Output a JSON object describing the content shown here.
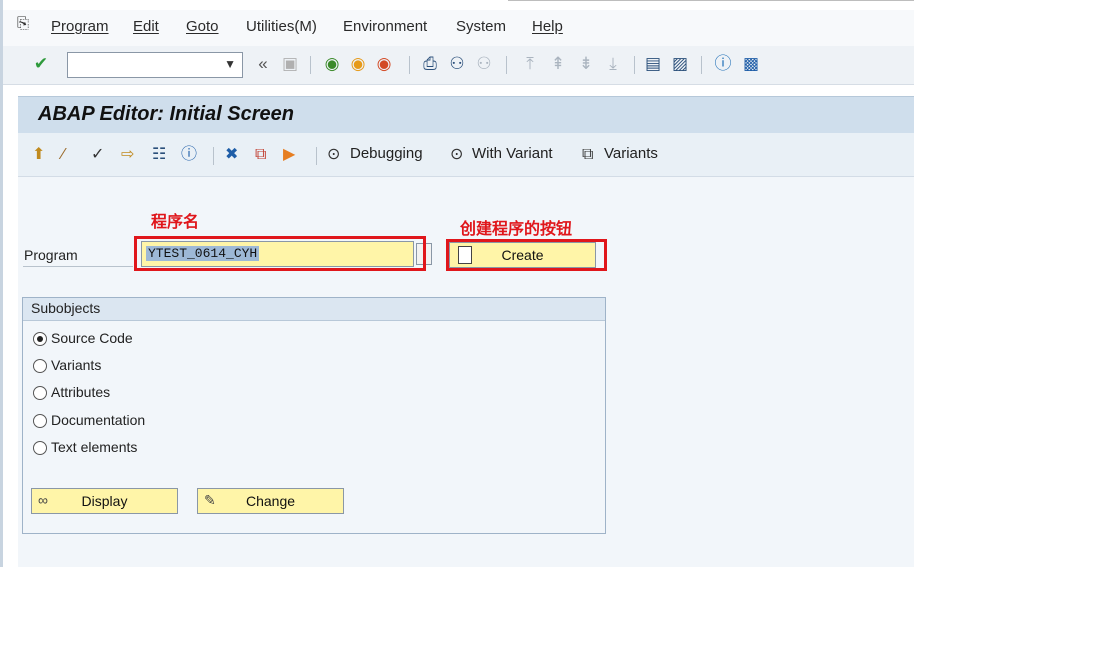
{
  "menu": {
    "items": [
      "Program",
      "Edit",
      "Goto",
      "Utilities(M)",
      "Environment",
      "System",
      "Help"
    ]
  },
  "toolbar": {
    "command_value": "",
    "icons": [
      "enter-icon",
      "back-arrows-icon",
      "save-icon",
      "back-icon",
      "exit-icon",
      "cancel-icon",
      "print-icon",
      "find-icon",
      "find-next-icon",
      "first-page-icon",
      "prev-page-icon",
      "next-page-icon",
      "last-page-icon",
      "new-session-icon",
      "shortcut-icon",
      "help-icon",
      "customize-layout-icon"
    ]
  },
  "title": "ABAP Editor: Initial Screen",
  "app_toolbar": {
    "debugging_label": "Debugging",
    "with_variant_label": "With Variant",
    "variants_label": "Variants"
  },
  "annotations": {
    "program_name": "程序名",
    "create_button_note": "创建程序的按钮"
  },
  "program": {
    "label": "Program",
    "value": "YTEST_0614_CYH"
  },
  "create": {
    "label": "Create"
  },
  "subobjects": {
    "title": "Subobjects",
    "options": [
      {
        "label": "Source Code",
        "selected": true
      },
      {
        "label": "Variants",
        "selected": false
      },
      {
        "label": "Attributes",
        "selected": false
      },
      {
        "label": "Documentation",
        "selected": false
      },
      {
        "label": "Text elements",
        "selected": false
      }
    ]
  },
  "buttons": {
    "display": "Display",
    "change": "Change"
  },
  "colors": {
    "title_bar": "#cfdeec",
    "input_yellow": "#fff5a8",
    "annotation_red": "#e0161b"
  }
}
